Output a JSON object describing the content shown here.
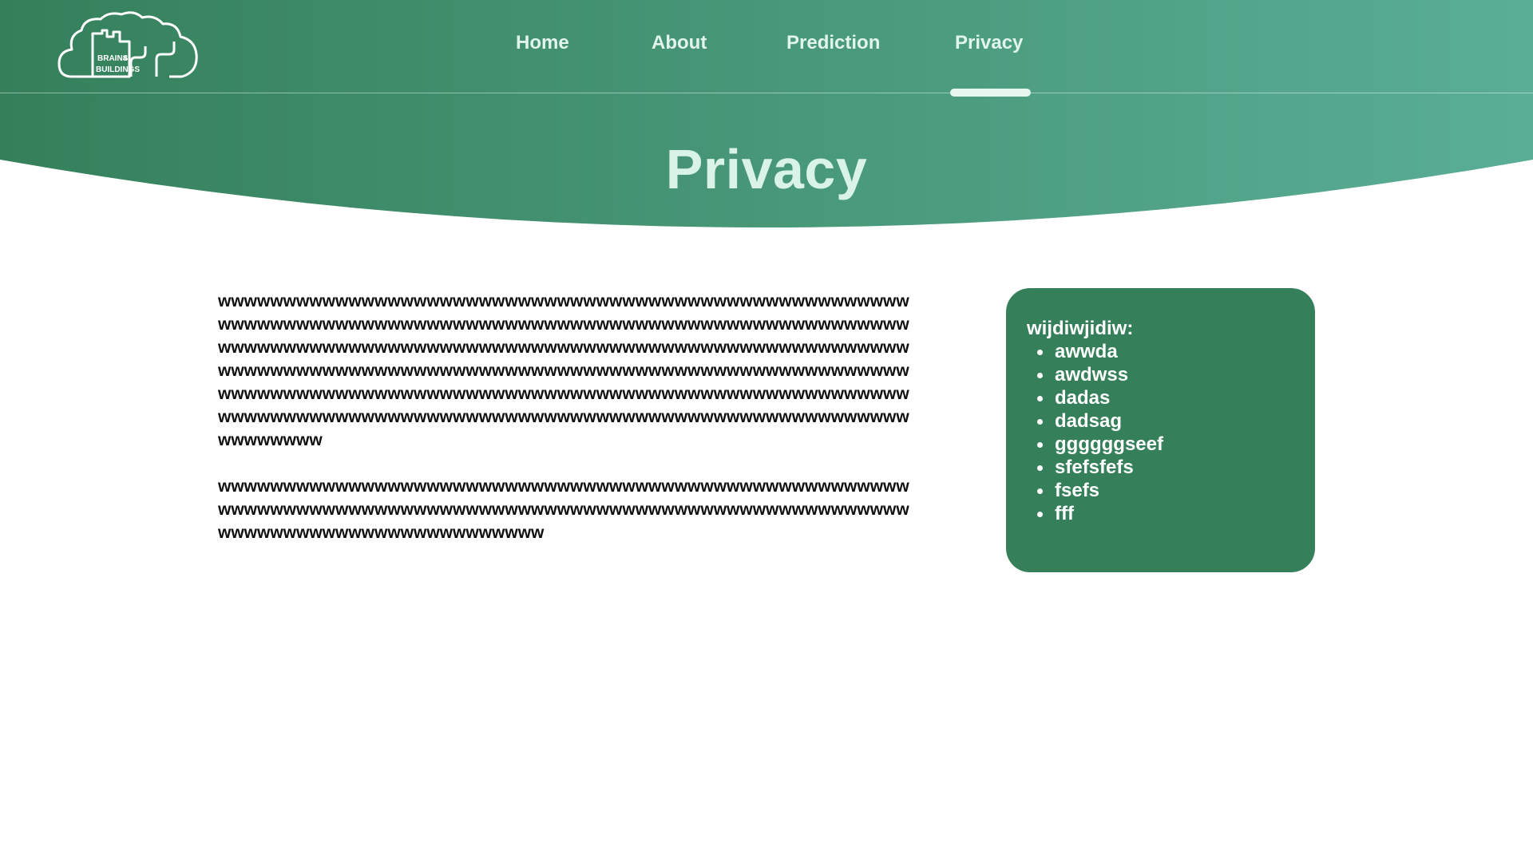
{
  "header": {
    "logo": {
      "text_line1": "BRAINS",
      "text_number": "4",
      "text_line2": "BUILDINGS"
    },
    "nav": [
      {
        "label": "Home"
      },
      {
        "label": "About"
      },
      {
        "label": "Prediction"
      },
      {
        "label": "Privacy",
        "active": true
      }
    ]
  },
  "hero": {
    "title": "Privacy"
  },
  "main": {
    "paragraphs": [
      "wwwwwwwwwwwwwwwwwwwwwwwwwwwwwwwwwwwwwwwwwwwwwwwwwwwwwwwwwwwwwwwwwwwwwwwwwwwwwwwwwwwwwwwwwwwwwwwwwwwwwwwwwwwwwwwwwwwwwwwwwwwwwwwwwwwwwwwwwwwwwwwwwwwwwwwwwwwwwwwwwwwwwwwwwwwwwwwwwwwwwwwwwwwwwwwwwwwwwwwwwwwwwwwwwwwwwwwwwwwwwwwwwwwwwwwwwwwwwwwwwwwwwwwwwwwwwwwwwwwwwwwwwwwwwwwwwwwwwwwwwwwwwwwwwwwwwwwwwwwwwwwwwwwwwwwwwwwwwwwwwwwwww",
      "wwwwwwwwwwwwwwwwwwwwwwwwwwwwwwwwwwwwwwwwwwwwwwwwwwwwwwwwwwwwwwwwwwwwwwwwwwwwwwwwwwwwwwwwwwwwwwwwwwwwwwwwwwwwwwwwwwwwwwwwwwwwwwwwwww"
    ]
  },
  "sidebar": {
    "title": "wijdiwjidiw:",
    "items": [
      "awwda",
      "awdwss",
      "dadas",
      "dadsag",
      "ggggggseef",
      "sfefsfefs",
      "fsefs",
      "fff"
    ]
  },
  "colors": {
    "gradient_start": "#35805b",
    "gradient_end": "#5aae96",
    "card_bg": "#35805b",
    "title_text": "#d9f3e6",
    "nav_text": "#e2f5ec"
  }
}
